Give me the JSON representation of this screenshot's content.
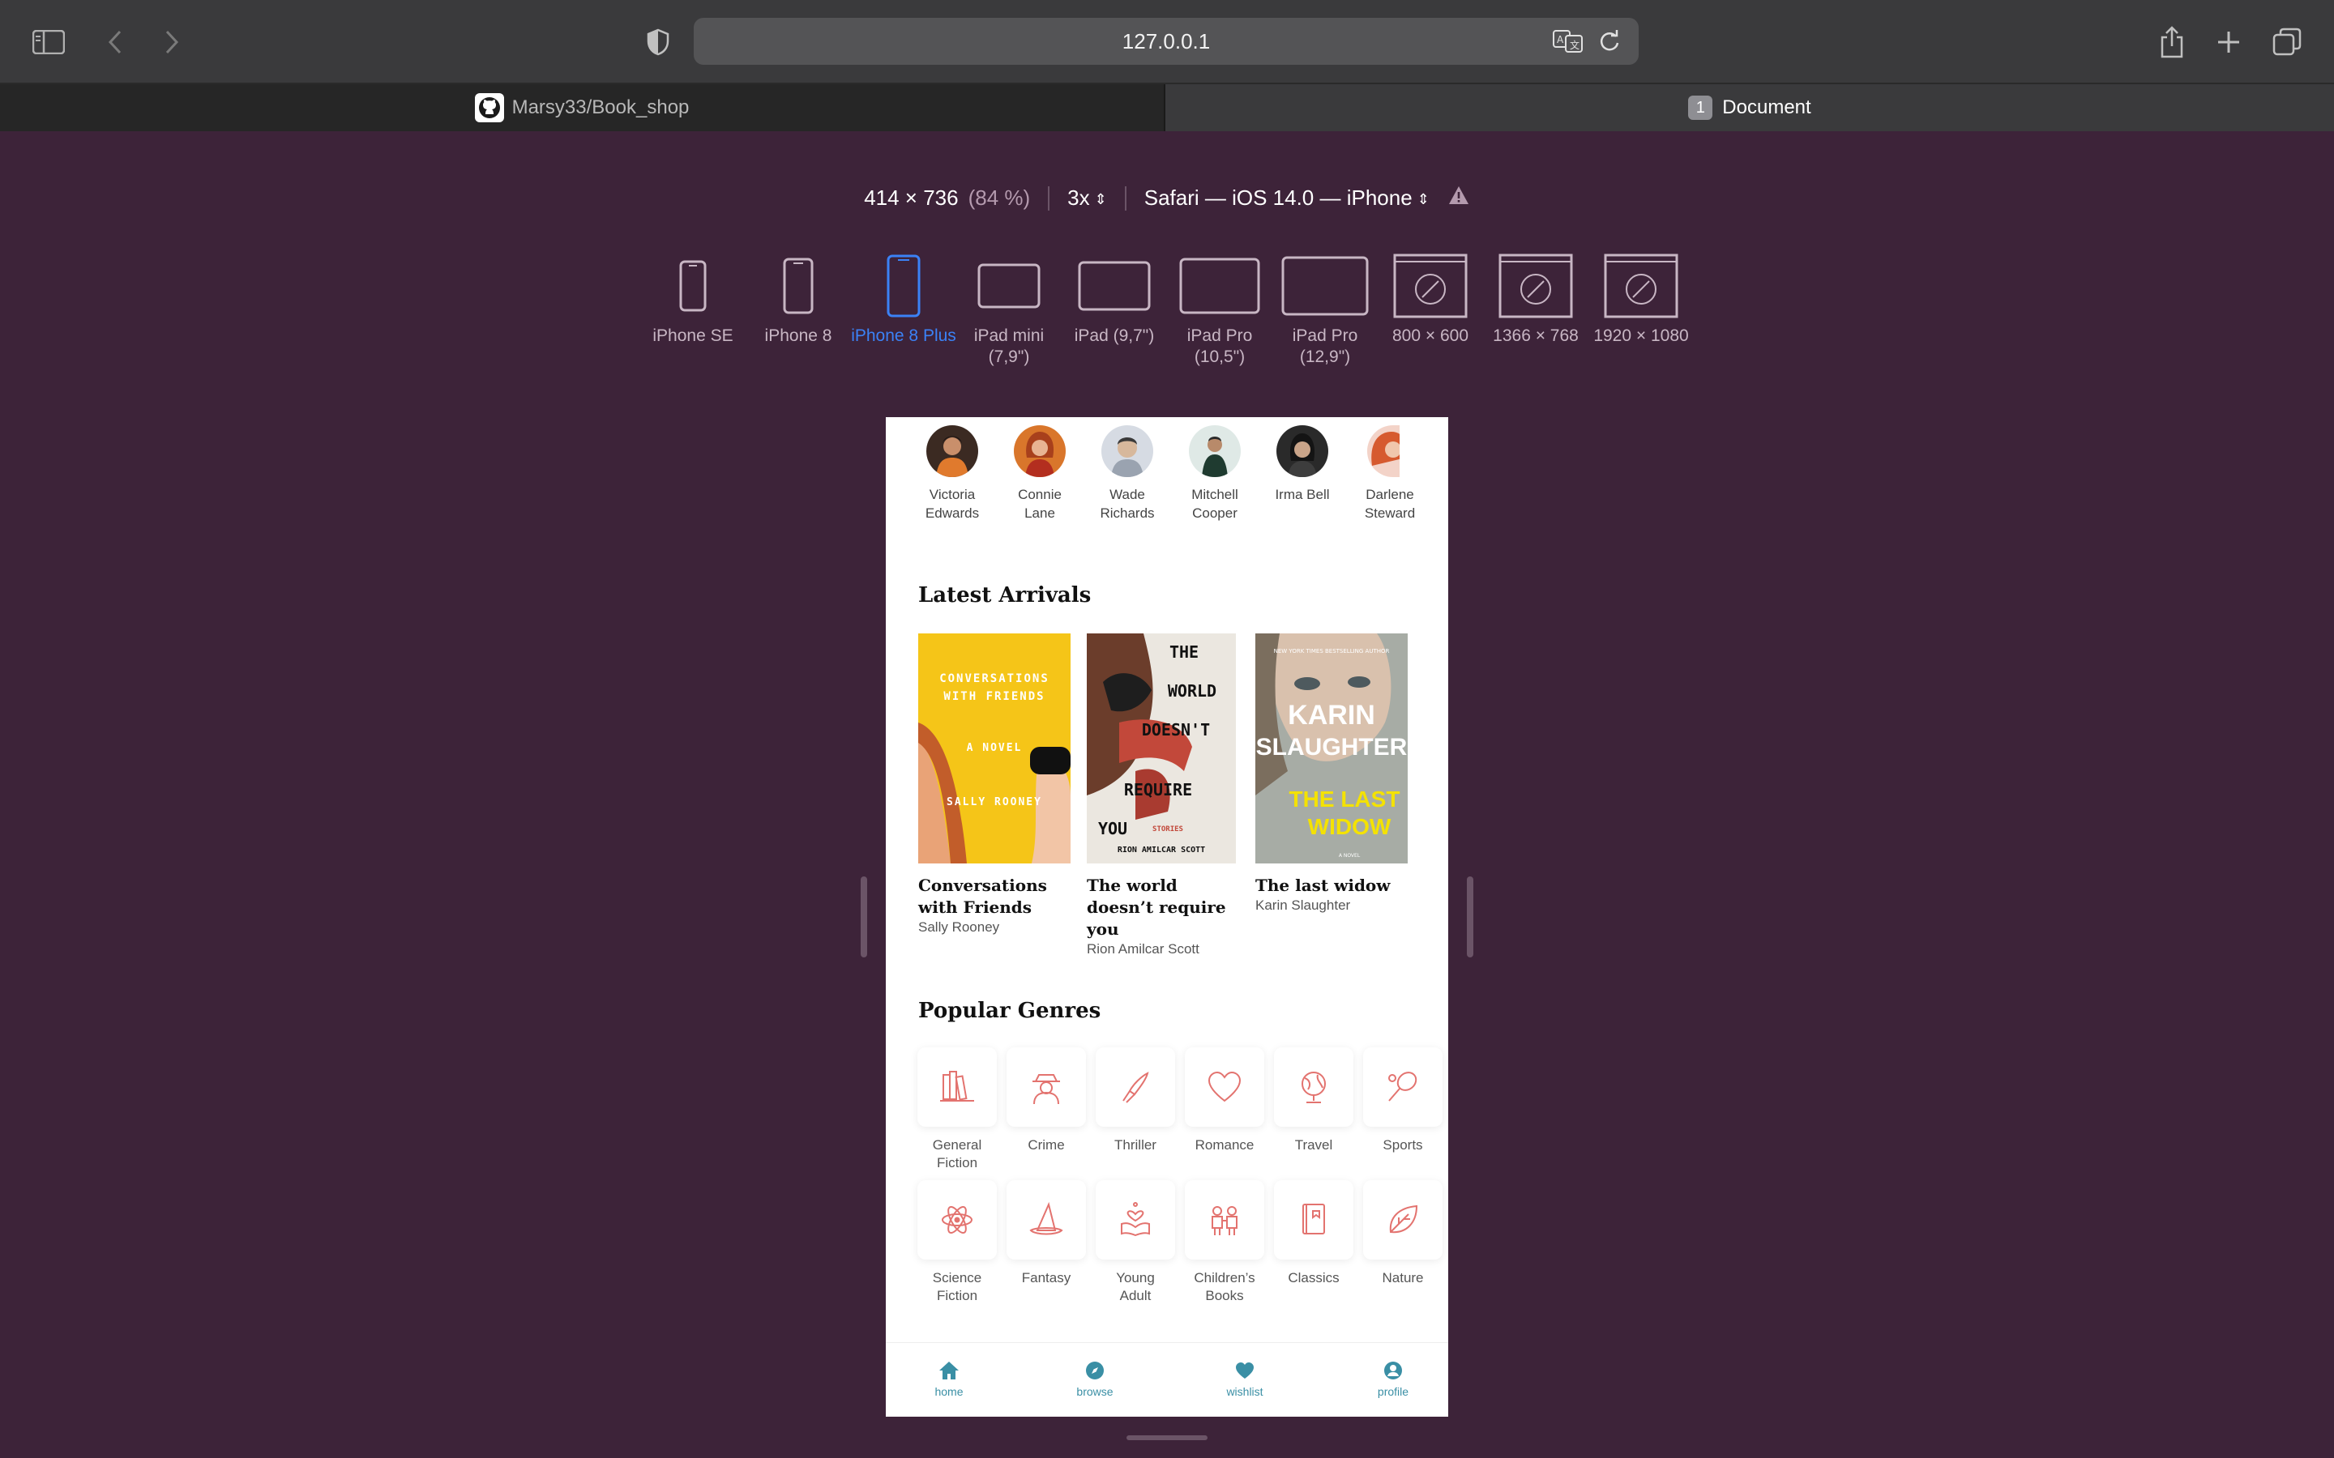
{
  "browser": {
    "url": "127.0.0.1",
    "tabs": [
      {
        "label": "Marsy33/Book_shop"
      },
      {
        "label": "Document",
        "badge": "1"
      }
    ]
  },
  "rdm": {
    "dimensions": "414 × 736",
    "zoom": "(84 %)",
    "scale": "3x",
    "user_agent": "Safari — iOS 14.0 — iPhone",
    "devices": [
      {
        "label": "iPhone SE"
      },
      {
        "label": "iPhone 8"
      },
      {
        "label": "iPhone 8 Plus"
      },
      {
        "label": "iPad mini (7,9\")"
      },
      {
        "label": "iPad (9,7\")"
      },
      {
        "label": "iPad Pro (10,5\")"
      },
      {
        "label": "iPad Pro (12,9\")"
      },
      {
        "label": "800 × 600"
      },
      {
        "label": "1366 × 768"
      },
      {
        "label": "1920 × 1080"
      }
    ],
    "active_device": "iPhone 8 Plus"
  },
  "page": {
    "authors": [
      {
        "name": "Victoria\nEdwards"
      },
      {
        "name": "Connie\nLane"
      },
      {
        "name": "Wade\nRichards"
      },
      {
        "name": "Mitchell\nCooper"
      },
      {
        "name": "Irma Bell"
      },
      {
        "name": "Darlene\nSteward"
      }
    ],
    "latest_title": "Latest Arrivals",
    "books": [
      {
        "title": "Conversations with Friends",
        "author": "Sally Rooney",
        "cover_lines": [
          "CONVERSATIONS",
          "WITH FRIENDS",
          "A NOVEL",
          "SALLY ROONEY"
        ]
      },
      {
        "title": "The world doesn’t require you",
        "author": "Rion Amilcar Scott",
        "cover_lines": [
          "THE",
          "WORLD",
          "DOESN'T",
          "REQUIRE",
          "YOU",
          "STORIES",
          "RION AMILCAR SCOTT"
        ]
      },
      {
        "title": "The last widow",
        "author": "Karin Slaughter",
        "cover_lines": [
          "NEW YORK TIMES BESTSELLING AUTHOR",
          "KARIN",
          "SLAUGHTER",
          "THE LAST",
          "WIDOW",
          "A NOVEL"
        ]
      }
    ],
    "genres_title": "Popular Genres",
    "genres": [
      {
        "label": "General\nFiction",
        "icon": "books-icon"
      },
      {
        "label": "Crime",
        "icon": "detective-icon"
      },
      {
        "label": "Thriller",
        "icon": "knife-icon"
      },
      {
        "label": "Romance",
        "icon": "heart-icon"
      },
      {
        "label": "Travel",
        "icon": "globe-icon"
      },
      {
        "label": "Sports",
        "icon": "racket-icon"
      },
      {
        "label": "Science\nFiction",
        "icon": "atom-icon"
      },
      {
        "label": "Fantasy",
        "icon": "wizard-hat-icon"
      },
      {
        "label": "Young\nAdult",
        "icon": "reader-icon"
      },
      {
        "label": "Children’s\nBooks",
        "icon": "children-icon"
      },
      {
        "label": "Classics",
        "icon": "book-icon"
      },
      {
        "label": "Nature",
        "icon": "leaf-icon"
      }
    ],
    "nav": [
      {
        "label": "home",
        "icon": "home-icon"
      },
      {
        "label": "browse",
        "icon": "compass-icon"
      },
      {
        "label": "wishlist",
        "icon": "heart-icon"
      },
      {
        "label": "profile",
        "icon": "user-icon"
      }
    ]
  },
  "colors": {
    "accent": "#e3736f",
    "nav": "#3a8fa5",
    "backdrop": "#3d2339",
    "active_device": "#3b82f6"
  }
}
